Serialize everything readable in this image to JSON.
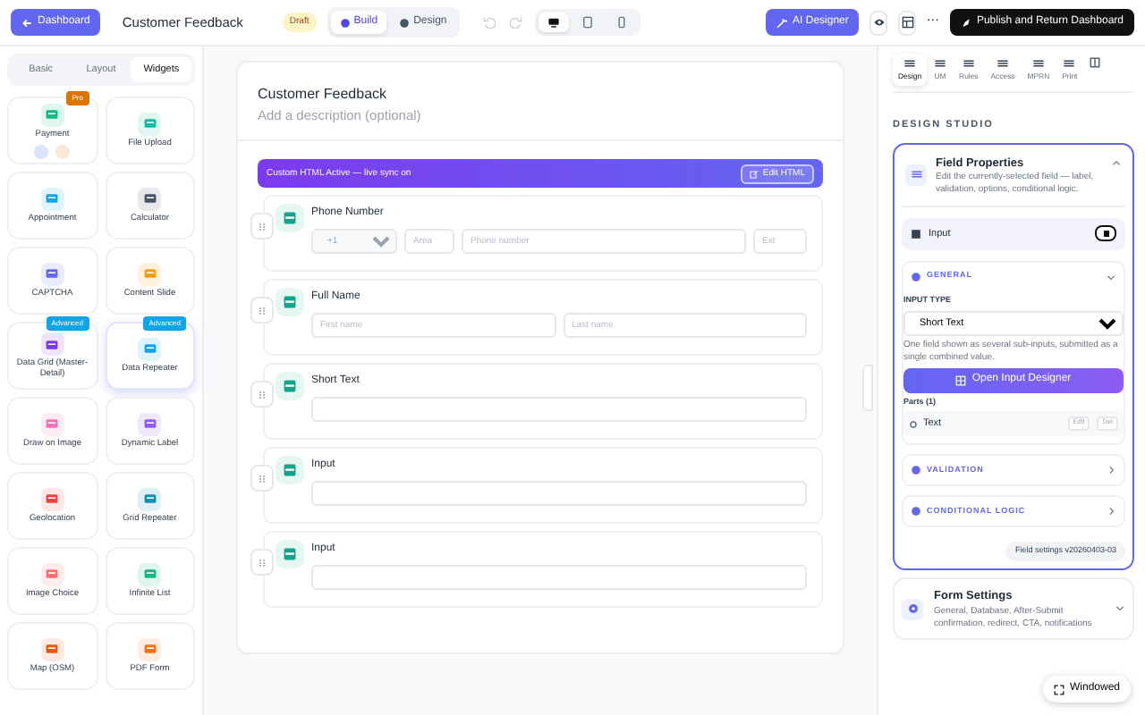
{
  "topbar": {
    "back_button": "Dashboard",
    "title": "Customer Feedback",
    "status_badge": "Draft",
    "modes": [
      {
        "label": "Build",
        "selected": true
      },
      {
        "label": "Design",
        "selected": false
      }
    ],
    "history": [
      {
        "kind": "undo",
        "disabled": true
      },
      {
        "kind": "redo",
        "disabled": true
      }
    ],
    "devices": [
      {
        "kind": "desktop",
        "selected": true
      },
      {
        "kind": "tablet",
        "selected": false
      },
      {
        "kind": "phone",
        "selected": false
      }
    ],
    "ai_button": "AI Designer",
    "more": "···",
    "publish_button": "Publish and Return Dashboard"
  },
  "palette": {
    "tabs": [
      {
        "label": "Basic",
        "selected": false
      },
      {
        "label": "Layout",
        "selected": false
      },
      {
        "label": "Widgets",
        "selected": true
      }
    ],
    "widgets": [
      {
        "label": "Payment",
        "color": "#10b981",
        "badge": {
          "text": "Pro",
          "color": "#d97706"
        },
        "selected": false,
        "methods": true
      },
      {
        "label": "File Upload",
        "color": "#14b8a6",
        "selected": false
      },
      {
        "label": "Appointment",
        "color": "#0ea5e9",
        "selected": false
      },
      {
        "label": "Calculator",
        "color": "#475569",
        "selected": false
      },
      {
        "label": "CAPTCHA",
        "color": "#6366f1",
        "selected": false
      },
      {
        "label": "Content Slide",
        "color": "#f59e0b",
        "selected": false
      },
      {
        "label": "Data Grid (Master-Detail)",
        "color": "#7c3aed",
        "badge": {
          "text": "Advanced",
          "color": "#0ea5e9"
        },
        "selected": false
      },
      {
        "label": "Data Repeater",
        "color": "#0ea5e9",
        "badge": {
          "text": "Advanced",
          "color": "#0ea5e9"
        },
        "selected": true
      },
      {
        "label": "Draw on Image",
        "color": "#f472b6",
        "selected": false
      },
      {
        "label": "Dynamic Label",
        "color": "#8b5cf6",
        "selected": false
      },
      {
        "label": "Geolocation",
        "color": "#ef4444",
        "selected": false
      },
      {
        "label": "Grid Repeater",
        "color": "#0891b2",
        "selected": false
      },
      {
        "label": "Image Choice",
        "color": "#f87171",
        "selected": false
      },
      {
        "label": "Infinite List",
        "color": "#10b981",
        "selected": false
      },
      {
        "label": "Map (OSM)",
        "color": "#ea580c",
        "selected": false
      },
      {
        "label": "PDF Form",
        "color": "#f97316",
        "selected": false
      }
    ]
  },
  "form": {
    "title": "Customer Feedback",
    "description_placeholder": "Add a description (optional)",
    "banner": "Custom HTML Active — live sync on",
    "banner_button": "Edit HTML",
    "fields": [
      {
        "kind": "phone",
        "label": "Phone Number",
        "country": "+1",
        "placeholders": [
          "Area",
          "Phone number",
          "Ext"
        ]
      },
      {
        "kind": "name",
        "label": "Full Name",
        "placeholders": [
          "First name",
          "Last name"
        ]
      },
      {
        "kind": "text",
        "label": "Short Text"
      },
      {
        "kind": "text",
        "label": "Input"
      },
      {
        "kind": "text",
        "label": "Input"
      }
    ]
  },
  "inspector": {
    "tabs": [
      {
        "label": "Design",
        "selected": true
      },
      {
        "label": "UM",
        "selected": false
      },
      {
        "label": "Rules",
        "selected": false
      },
      {
        "label": "Access",
        "selected": false
      },
      {
        "label": "MPRN",
        "selected": false
      },
      {
        "label": "Print",
        "selected": false
      }
    ],
    "heading": "DESIGN STUDIO",
    "field_properties": {
      "title": "Field Properties",
      "description": "Edit the currently-selected field — label, validation, options, conditional logic.",
      "expanded": true,
      "field_name": "Input",
      "sections": [
        {
          "title": "GENERAL",
          "expanded": true
        },
        {
          "title": "VALIDATION",
          "expanded": false
        },
        {
          "title": "CONDITIONAL LOGIC",
          "expanded": false
        }
      ],
      "input_type_label": "INPUT TYPE",
      "input_type": "Short Text",
      "hint": "One field shown as several sub-inputs, submitted as a single combined value.",
      "designer_button": "Open Input Designer",
      "parts_label": "Parts (1)",
      "parts": [
        {
          "label": "Text",
          "actions": [
            "Edit",
            "Del"
          ]
        }
      ],
      "version": "Field settings v20260403-03"
    },
    "form_settings": {
      "title": "Form Settings",
      "description": "General, Database, After-Submit confirmation, redirect, CTA, notifications",
      "expanded": false
    }
  },
  "windowed_button": "Windowed"
}
